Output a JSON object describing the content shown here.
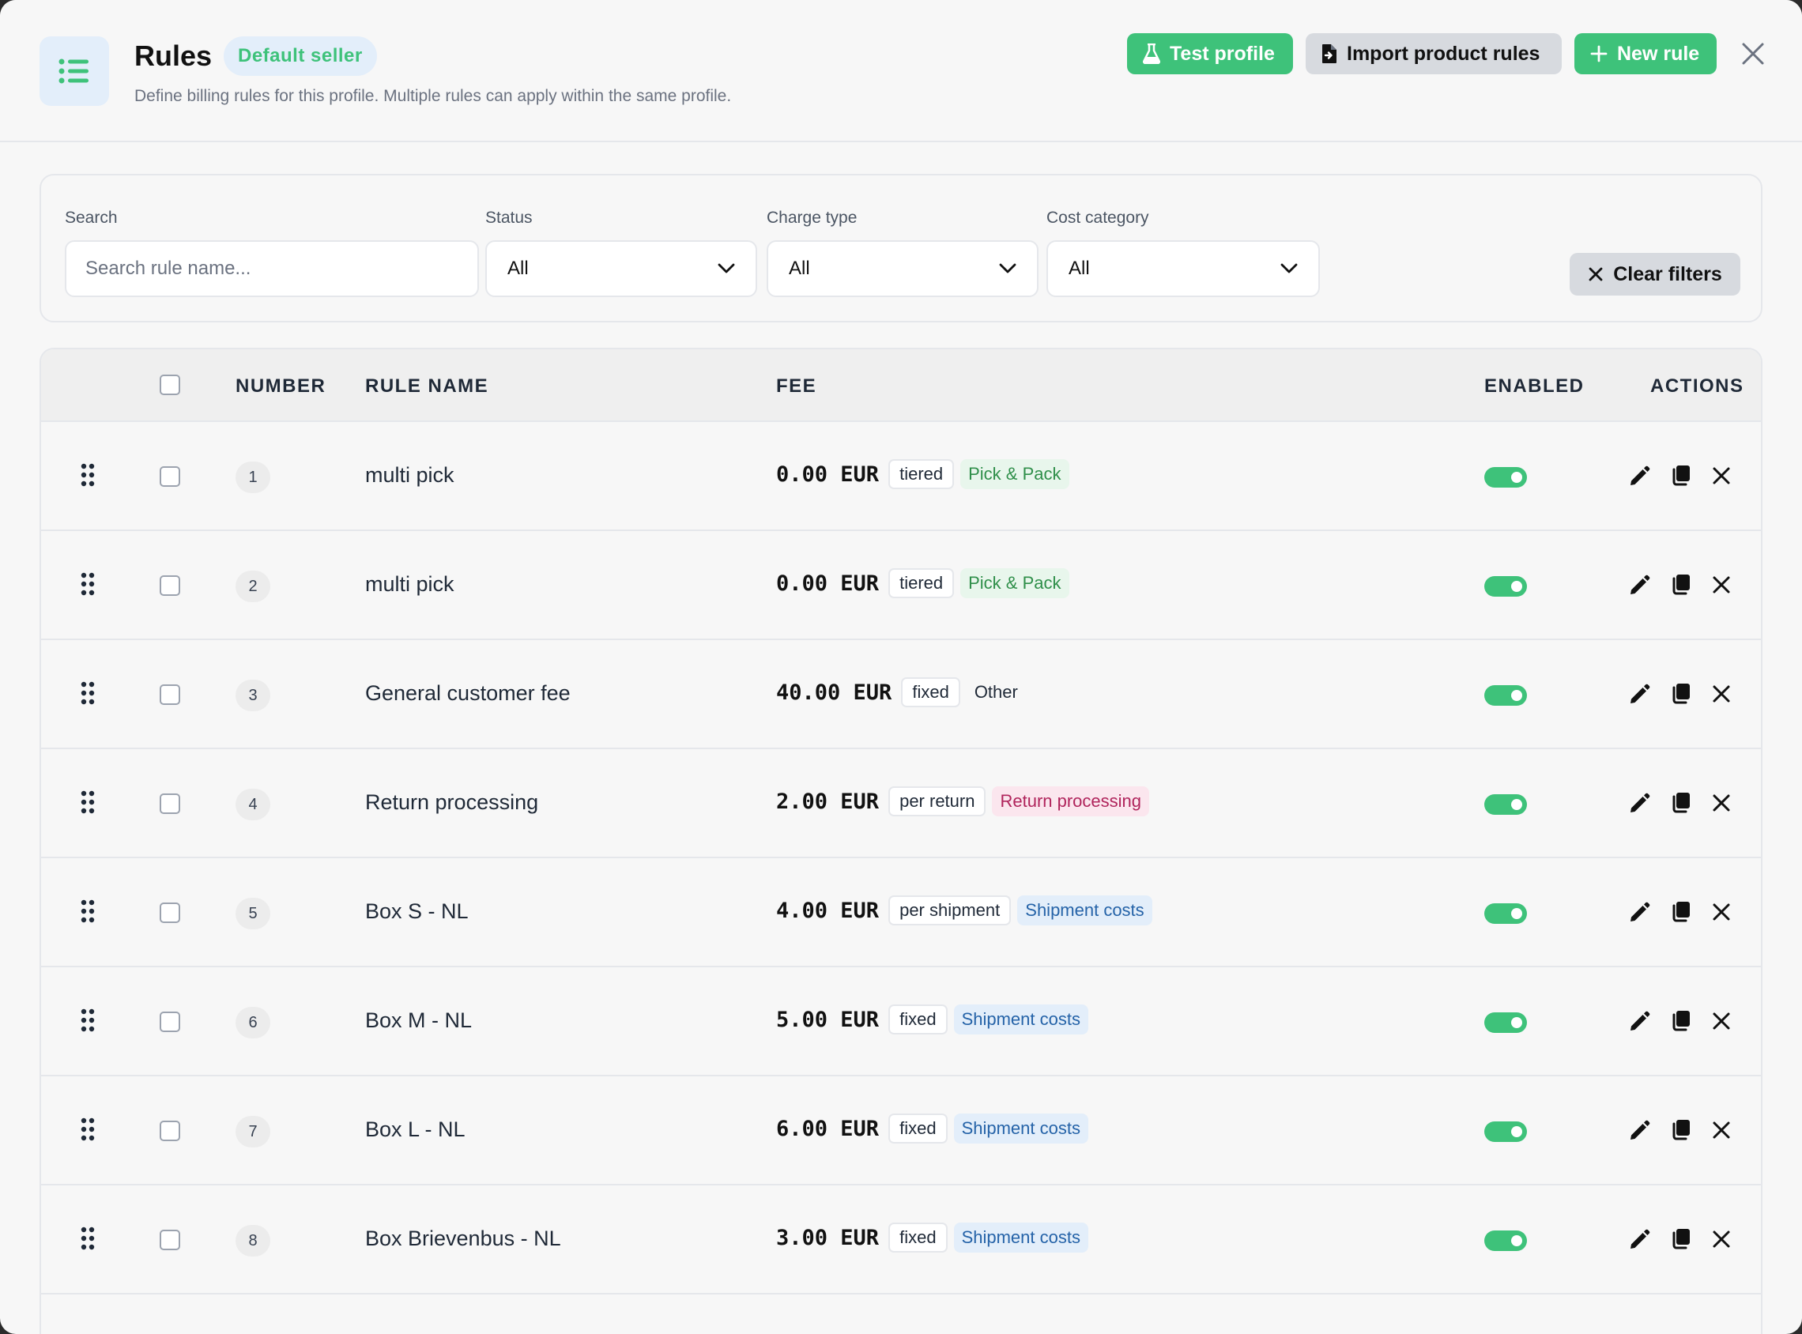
{
  "header": {
    "title": "Rules",
    "badge": "Default seller",
    "subtitle": "Define billing rules for this profile. Multiple rules can apply within the same profile.",
    "test_profile_label": "Test profile",
    "import_label": "Import product rules",
    "new_rule_label": "New rule"
  },
  "filters": {
    "search_label": "Search",
    "search_placeholder": "Search rule name...",
    "search_value": "",
    "status_label": "Status",
    "status_value": "All",
    "charge_type_label": "Charge type",
    "charge_type_value": "All",
    "cost_category_label": "Cost category",
    "cost_category_value": "All",
    "clear_label": "Clear filters"
  },
  "table": {
    "columns": {
      "number": "NUMBER",
      "rule_name": "RULE NAME",
      "fee": "FEE",
      "enabled": "ENABLED",
      "actions": "ACTIONS"
    },
    "rows": [
      {
        "number": "1",
        "name": "multi pick",
        "amount": "0.00",
        "currency": "EUR",
        "charge_type": "tiered",
        "category": "Pick & Pack",
        "category_style": "pick",
        "enabled": true
      },
      {
        "number": "2",
        "name": "multi pick",
        "amount": "0.00",
        "currency": "EUR",
        "charge_type": "tiered",
        "category": "Pick & Pack",
        "category_style": "pick",
        "enabled": true
      },
      {
        "number": "3",
        "name": "General customer fee",
        "amount": "40.00",
        "currency": "EUR",
        "charge_type": "fixed",
        "category": "Other",
        "category_style": "other",
        "enabled": true
      },
      {
        "number": "4",
        "name": "Return processing",
        "amount": "2.00",
        "currency": "EUR",
        "charge_type": "per return",
        "category": "Return processing",
        "category_style": "return",
        "enabled": true
      },
      {
        "number": "5",
        "name": "Box S - NL",
        "amount": "4.00",
        "currency": "EUR",
        "charge_type": "per shipment",
        "category": "Shipment costs",
        "category_style": "shipment",
        "enabled": true
      },
      {
        "number": "6",
        "name": "Box M - NL",
        "amount": "5.00",
        "currency": "EUR",
        "charge_type": "fixed",
        "category": "Shipment costs",
        "category_style": "shipment",
        "enabled": true
      },
      {
        "number": "7",
        "name": "Box L - NL",
        "amount": "6.00",
        "currency": "EUR",
        "charge_type": "fixed",
        "category": "Shipment costs",
        "category_style": "shipment",
        "enabled": true
      },
      {
        "number": "8",
        "name": "Box Brievenbus - NL",
        "amount": "3.00",
        "currency": "EUR",
        "charge_type": "fixed",
        "category": "Shipment costs",
        "category_style": "shipment",
        "enabled": true
      }
    ]
  },
  "colors": {
    "accent_green": "#3ec27a",
    "pick_bg": "#e8f6ec",
    "pick_fg": "#2f8f4a",
    "return_bg": "#fbe6ee",
    "return_fg": "#b0245c",
    "shipment_bg": "#e3eefa",
    "shipment_fg": "#2563a8",
    "other_fg": "#1f2937"
  },
  "icons": {
    "header": "list-icon",
    "test": "flask-icon",
    "import": "file-import-icon",
    "new": "plus-icon",
    "close": "close-icon",
    "drag": "drag-handle-icon",
    "edit": "pencil-icon",
    "copy": "copy-icon",
    "delete": "x-icon",
    "select": "chevron-down-icon"
  }
}
